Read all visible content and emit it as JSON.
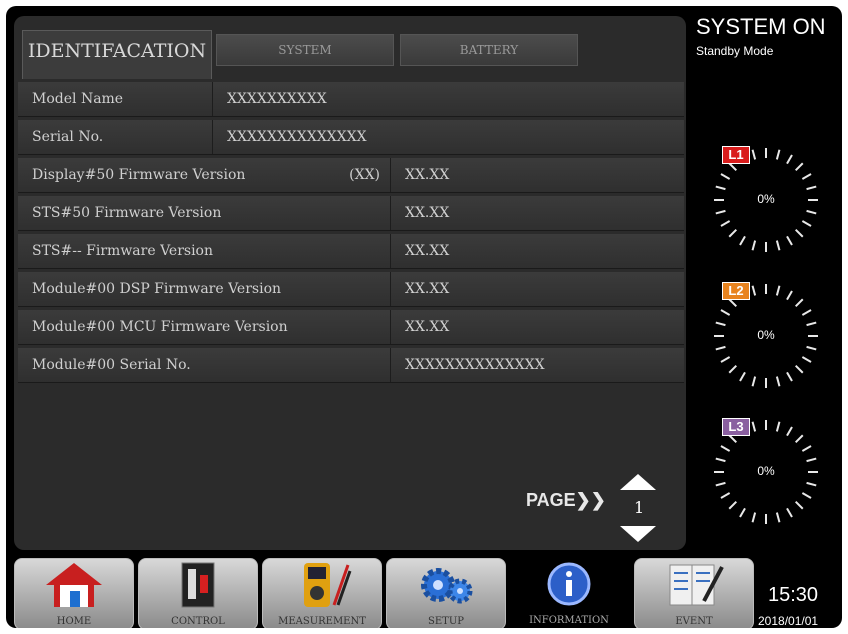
{
  "tabs": [
    {
      "label": "IDENTIFACATION"
    },
    {
      "label": "SYSTEM"
    },
    {
      "label": "BATTERY"
    }
  ],
  "rows": [
    {
      "label": "Model Name",
      "value": "XXXXXXXXXX"
    },
    {
      "label": "Serial No.",
      "value": "XXXXXXXXXXXXXX"
    },
    {
      "label": "Display#50 Firmware Version",
      "tag": "(XX)",
      "value": "XX.XX"
    },
    {
      "label": "STS#50 Firmware Version",
      "value": "XX.XX"
    },
    {
      "label": "STS#-- Firmware Version",
      "value": "XX.XX"
    },
    {
      "label": "Module#00 DSP Firmware Version",
      "value": "XX.XX"
    },
    {
      "label": "Module#00 MCU Firmware Version",
      "value": "XX.XX"
    },
    {
      "label": "Module#00 Serial No.",
      "value": "XXXXXXXXXXXXXX"
    }
  ],
  "pager": {
    "label": "PAGE❯❯",
    "page": "1"
  },
  "status": {
    "title": "SYSTEM ON",
    "mode": "Standby Mode"
  },
  "gauges": [
    {
      "label": "L1",
      "value": "0%",
      "color": "#d91c1c"
    },
    {
      "label": "L2",
      "value": "0%",
      "color": "#e8831e"
    },
    {
      "label": "L3",
      "value": "0%",
      "color": "#8a5fa0"
    }
  ],
  "nav": [
    {
      "label": "HOME",
      "icon": "home-icon"
    },
    {
      "label": "CONTROL",
      "icon": "control-icon"
    },
    {
      "label": "MEASUREMENT",
      "icon": "multimeter-icon"
    },
    {
      "label": "SETUP",
      "icon": "gears-icon"
    },
    {
      "label": "INFORMATION",
      "icon": "info-icon"
    },
    {
      "label": "EVENT",
      "icon": "event-log-icon"
    }
  ],
  "clock": {
    "time": "15:30",
    "date": "2018/01/01"
  }
}
